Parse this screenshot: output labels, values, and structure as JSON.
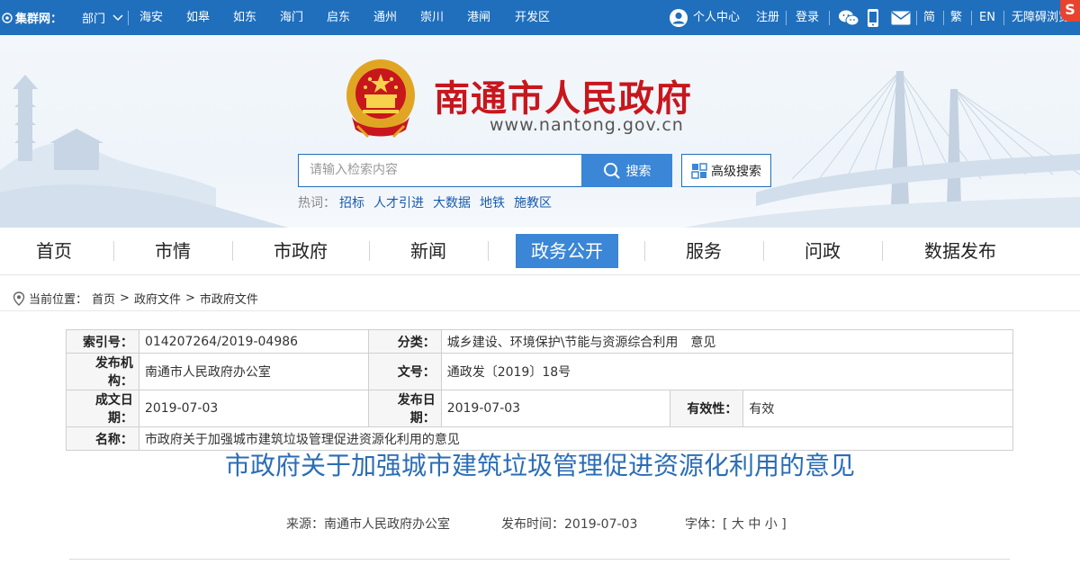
{
  "topbar": {
    "group_label": "集群网：",
    "department": "部门",
    "cities": [
      "海安",
      "如皋",
      "如东",
      "海门",
      "启东",
      "通州",
      "崇川",
      "港闸",
      "开发区"
    ],
    "personal_center": "个人中心",
    "register": "注册",
    "login": "登录",
    "lang_simplified": "简",
    "lang_traditional": "繁",
    "lang_english": "EN",
    "accessibility": "无障碍浏览"
  },
  "header": {
    "site_title": "南通市人民政府",
    "site_url": "www.nantong.gov.cn",
    "search_placeholder": "请输入检索内容",
    "search_button": "搜索",
    "advanced_search": "高级搜索",
    "hot_label": "热词：",
    "hot_words": [
      "招标",
      "人才引进",
      "大数据",
      "地铁",
      "施教区"
    ]
  },
  "nav": {
    "items": [
      "首页",
      "市情",
      "市政府",
      "新闻",
      "政务公开",
      "服务",
      "问政",
      "数据发布"
    ],
    "active_index": 4
  },
  "breadcrumb": {
    "label": "当前位置：",
    "items": [
      "首页",
      "政府文件",
      "市政府文件"
    ],
    "separator": ">"
  },
  "info": {
    "index_label": "索引号：",
    "index_value": "014207264/2019-04986",
    "category_label": "分类：",
    "category_value": "城乡建设、环境保护\\节能与资源综合利用　意见",
    "publisher_label": "发布机构：",
    "publisher_value": "南通市人民政府办公室",
    "doc_no_label": "文号：",
    "doc_no_value": "通政发〔2019〕18号",
    "created_label": "成文日期：",
    "created_value": "2019-07-03",
    "published_label": "发布日期：",
    "published_value": "2019-07-03",
    "validity_label": "有效性：",
    "validity_value": "有效",
    "name_label": "名称：",
    "name_value": "市政府关于加强城市建筑垃圾管理促进资源化利用的意见"
  },
  "article": {
    "title": "市政府关于加强城市建筑垃圾管理促进资源化利用的意见",
    "source": "来源：南通市人民政府办公室",
    "publish_time": "发布时间：2019-07-03",
    "font_size_label": "字体：[ 大 中 小 ]"
  },
  "colors": {
    "topbar_bg": "#1f6fbd",
    "title_red": "#c8161d",
    "accent_blue": "#3b86d6",
    "article_title": "#2b6db5"
  },
  "icons": {
    "topbar": [
      "cluster-icon",
      "chevron-down-icon",
      "user-icon",
      "wechat-icon",
      "mobile-icon",
      "mail-icon"
    ],
    "header": [
      "national-emblem-icon",
      "search-icon",
      "advanced-search-icon"
    ],
    "breadcrumb": [
      "location-pin-icon"
    ]
  }
}
